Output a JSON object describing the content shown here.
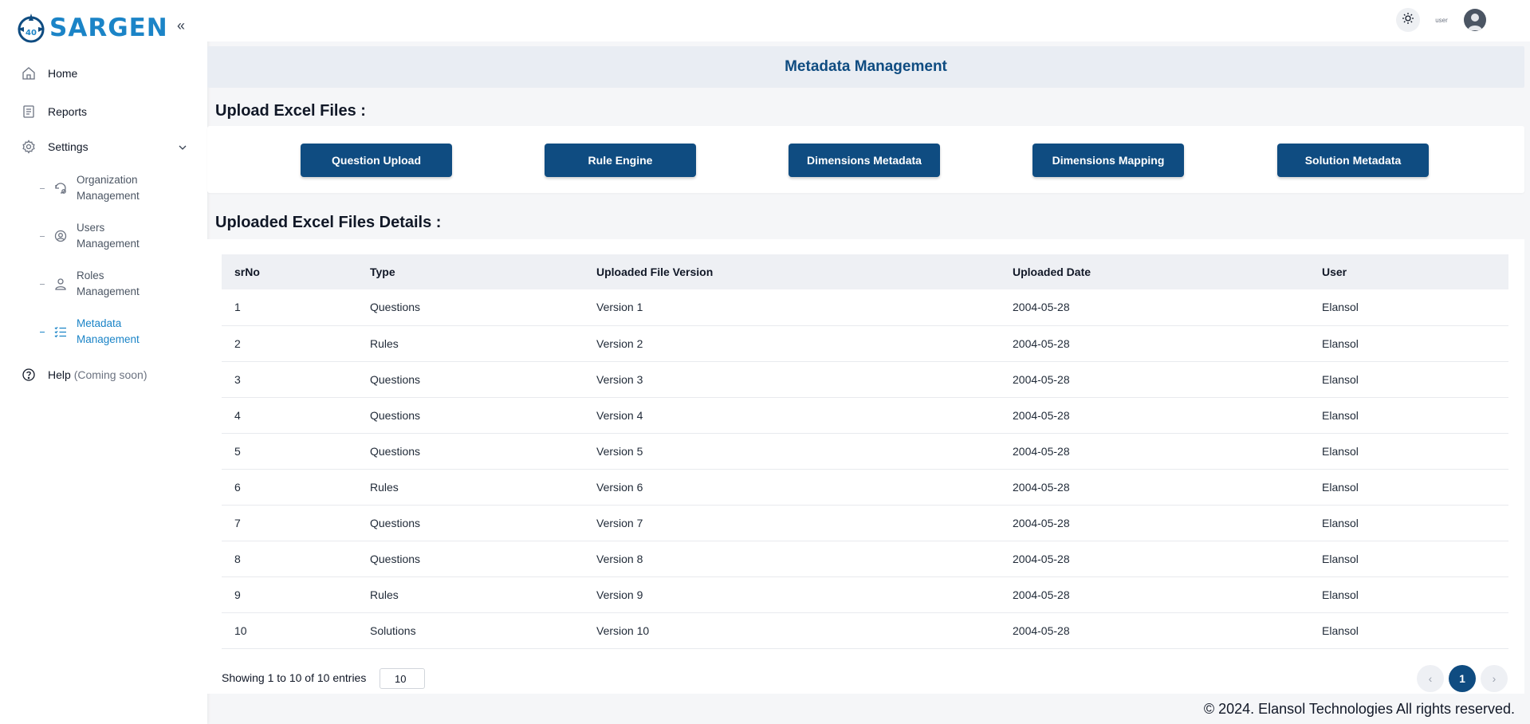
{
  "app": {
    "logo_text": "SARGEN",
    "logo_badge": "40"
  },
  "sidebar": {
    "home": "Home",
    "reports": "Reports",
    "settings": "Settings",
    "sub_items": [
      {
        "label_line1": "Organization",
        "label_line2": "Management"
      },
      {
        "label_line1": "Users",
        "label_line2": "Management"
      },
      {
        "label_line1": "Roles",
        "label_line2": "Management"
      },
      {
        "label_line1": "Metadata",
        "label_line2": "Management"
      }
    ],
    "help": "Help",
    "help_note": "(Coming soon)"
  },
  "topbar": {
    "lang_alt": "user"
  },
  "page": {
    "title": "Metadata Management",
    "upload_title": "Upload Excel Files :",
    "details_title": "Uploaded Excel Files Details :"
  },
  "upload_buttons": [
    "Question Upload",
    "Rule Engine",
    "Dimensions Metadata",
    "Dimensions Mapping",
    "Solution Metadata"
  ],
  "table": {
    "headers": [
      "srNo",
      "Type",
      "Uploaded File Version",
      "Uploaded Date",
      "User"
    ],
    "rows": [
      [
        "1",
        "Questions",
        "Version 1",
        "2004-05-28",
        "Elansol"
      ],
      [
        "2",
        "Rules",
        "Version 2",
        "2004-05-28",
        "Elansol"
      ],
      [
        "3",
        "Questions",
        "Version 3",
        "2004-05-28",
        "Elansol"
      ],
      [
        "4",
        "Questions",
        "Version 4",
        "2004-05-28",
        "Elansol"
      ],
      [
        "5",
        "Questions",
        "Version 5",
        "2004-05-28",
        "Elansol"
      ],
      [
        "6",
        "Rules",
        "Version 6",
        "2004-05-28",
        "Elansol"
      ],
      [
        "7",
        "Questions",
        "Version 7",
        "2004-05-28",
        "Elansol"
      ],
      [
        "8",
        "Questions",
        "Version 8",
        "2004-05-28",
        "Elansol"
      ],
      [
        "9",
        "Rules",
        "Version 9",
        "2004-05-28",
        "Elansol"
      ],
      [
        "10",
        "Solutions",
        "Version 10",
        "2004-05-28",
        "Elansol"
      ]
    ]
  },
  "pagination": {
    "showing": "Showing 1 to 10 of 10 entries",
    "page_size": "10",
    "current_page": "1",
    "prev": "‹",
    "next": "›"
  },
  "footer": "© 2024. Elansol Technologies All rights reserved.",
  "colors": {
    "primary": "#0f4c81",
    "accent": "#1b84c7"
  },
  "icons": [
    "home-icon",
    "reports-icon",
    "settings-icon",
    "chevron-down-icon",
    "org-icon",
    "users-icon",
    "roles-icon",
    "list-icon",
    "help-icon",
    "sun-icon",
    "avatar-icon",
    "collapse-icon"
  ]
}
